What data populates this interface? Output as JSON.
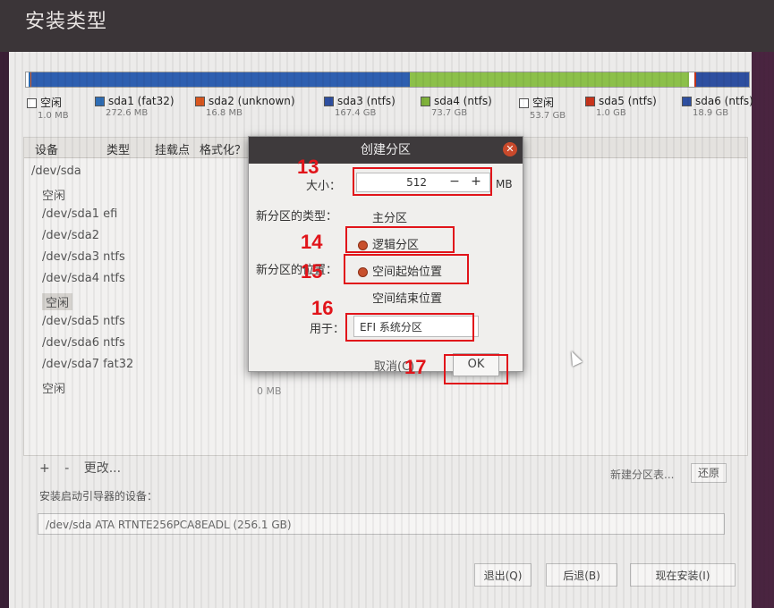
{
  "window": {
    "title": "安装类型"
  },
  "partition_legend": [
    {
      "name": "空闲",
      "size": "1.0 MB",
      "color": "#ffffff"
    },
    {
      "name": "sda1 (fat32)",
      "size": "272.6 MB",
      "color": "#2e6db5"
    },
    {
      "name": "sda2 (unknown)",
      "size": "16.8 MB",
      "color": "#d9571f"
    },
    {
      "name": "sda3 (ntfs)",
      "size": "167.4 GB",
      "color": "#2e4fa0"
    },
    {
      "name": "sda4 (ntfs)",
      "size": "73.7 GB",
      "color": "#7fb23a"
    },
    {
      "name": "空闲",
      "size": "53.7 GB",
      "color": "#ffffff"
    },
    {
      "name": "sda5 (ntfs)",
      "size": "1.0 GB",
      "color": "#c8341c"
    },
    {
      "name": "sda6 (ntfs)",
      "size": "18.9 GB",
      "color": "#2e4fa0"
    }
  ],
  "table": {
    "headers": [
      "设备",
      "类型",
      "挂载点",
      "格式化？"
    ],
    "rows": [
      "/dev/sda",
      "空闲",
      "/dev/sda1 efi",
      "/dev/sda2",
      "/dev/sda3 ntfs",
      "/dev/sda4 ntfs",
      "空闲",
      "/dev/sda5 ntfs",
      "/dev/sda6 ntfs",
      "/dev/sda7 fat32",
      "空闲"
    ]
  },
  "toolbar": {
    "add": "+",
    "remove": "-",
    "change": "更改..."
  },
  "new_partition_table": "新建分区表...",
  "revert": "还原",
  "boot_loader_label": "安装启动引导器的设备：",
  "boot_loader_device": "/dev/sda    ATA RTNTE256PCA8EADL (256.1 GB)",
  "buttons": {
    "quit": "退出(Q)",
    "back": "后退(B)",
    "install_now": "现在安装(I)"
  },
  "dialog": {
    "title": "创建分区",
    "size_label": "大小：",
    "size_value": "512",
    "size_unit": "MB",
    "minus": "−",
    "plus": "+",
    "type_label": "新分区的类型：",
    "type_primary": "主分区",
    "type_logical": "逻辑分区",
    "location_label": "新分区的位置：",
    "location_start": "空间起始位置",
    "location_end": "空间结束位置",
    "use_label": "用于：",
    "use_value": "EFI 系统分区",
    "cancel": "取消(C)",
    "ok": "OK"
  },
  "free_size": "0 MB",
  "annotations": {
    "n13": "13",
    "n14": "14",
    "n15": "15",
    "n16": "16",
    "n17": "17"
  }
}
